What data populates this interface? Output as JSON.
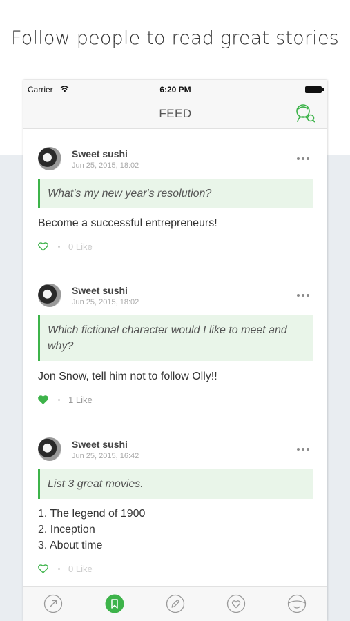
{
  "headline": "Follow people to read great stories",
  "status_bar": {
    "carrier": "Carrier",
    "time": "6:20 PM",
    "wifi_icon": "wifi-icon",
    "battery_icon": "battery-icon"
  },
  "nav": {
    "title": "FEED",
    "right_icon": "find-friends-icon"
  },
  "colors": {
    "accent": "#3db34a",
    "question_bg": "#e9f5e9",
    "band_bg": "#e9edf1"
  },
  "posts": [
    {
      "author": "Sweet sushi",
      "date": "Jun 25, 2015, 18:02",
      "question": "What's my new year's resolution?",
      "answer": "Become a successful entrepreneurs!",
      "likes": "0 Like",
      "liked": false
    },
    {
      "author": "Sweet sushi",
      "date": "Jun 25, 2015, 18:02",
      "question": "Which fictional character would I like to meet and why?",
      "answer": "Jon Snow, tell him not to follow Olly!!",
      "likes": "1 Like",
      "liked": true
    },
    {
      "author": "Sweet sushi",
      "date": "Jun 25, 2015, 16:42",
      "question": "List 3 great movies.",
      "answer": "1. The legend of 1900\n2. Inception\n3. About time",
      "likes": "0 Like",
      "liked": false
    }
  ],
  "tabs": [
    {
      "icon": "explore-icon",
      "active": false
    },
    {
      "icon": "bookmark-icon",
      "active": true
    },
    {
      "icon": "write-icon",
      "active": false
    },
    {
      "icon": "heart-icon",
      "active": false
    },
    {
      "icon": "profile-icon",
      "active": false
    }
  ]
}
